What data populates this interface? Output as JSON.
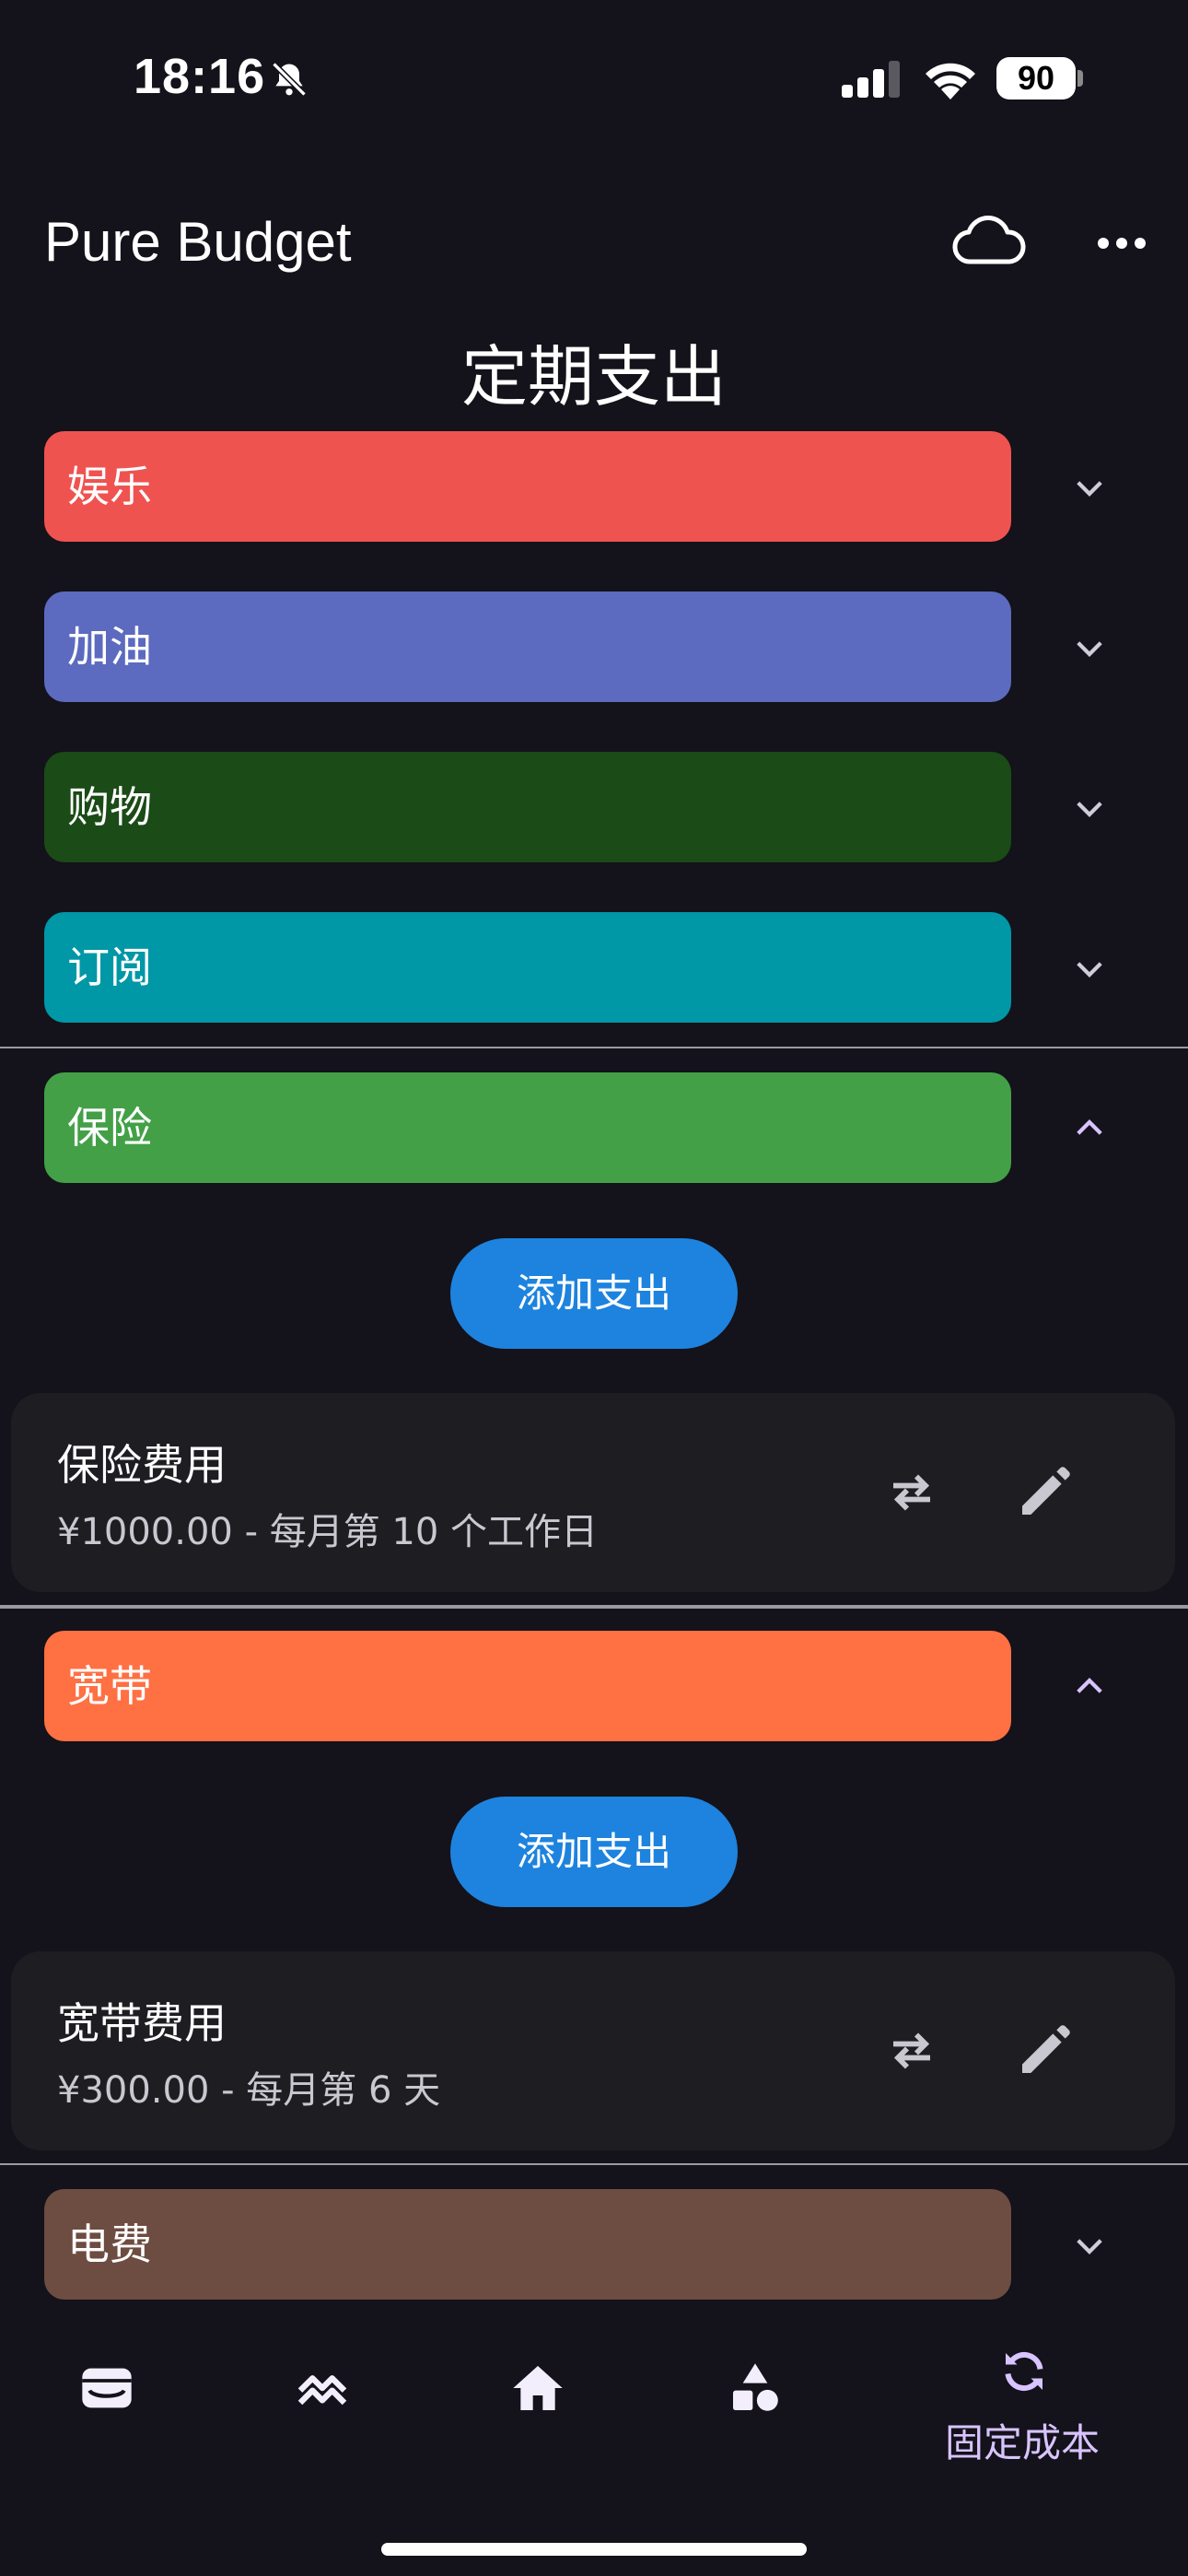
{
  "status_bar": {
    "time": "18:16",
    "battery": "90"
  },
  "header": {
    "app_title": "Pure Budget",
    "page_title": "定期支出"
  },
  "categories": [
    {
      "label": "娱乐",
      "color": "#ef5350",
      "expanded": false
    },
    {
      "label": "加油",
      "color": "#5c6bc0",
      "expanded": false
    },
    {
      "label": "购物",
      "color": "#1b4b17",
      "expanded": false
    },
    {
      "label": "订阅",
      "color": "#0097a7",
      "expanded": false
    },
    {
      "label": "保险",
      "color": "#43a047",
      "expanded": true
    },
    {
      "label": "宽带",
      "color": "#ff7043",
      "expanded": true
    },
    {
      "label": "电费",
      "color": "#6d4c41",
      "expanded": false
    }
  ],
  "add_button_label": "添加支出",
  "expenses": [
    {
      "name": "保险费用",
      "detail": "¥1000.00 - 每月第 10 个工作日"
    },
    {
      "name": "宽带费用",
      "detail": "¥300.00 - 每月第 6 天"
    }
  ],
  "bottom_nav": {
    "items": [
      "wallet-icon",
      "trend-icon",
      "home-icon",
      "categories-icon",
      "recurring-icon"
    ],
    "active_label": "固定成本",
    "accent": "#d8c4ff"
  }
}
